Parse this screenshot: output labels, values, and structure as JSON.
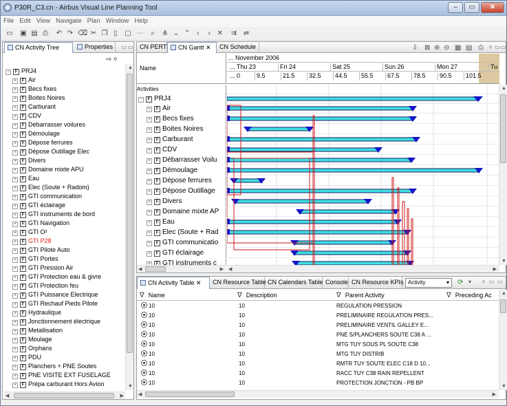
{
  "window": {
    "title": "P30R_C3.cn - Airbus Visual Line Planning Tool"
  },
  "menu": [
    "File",
    "Edit",
    "View",
    "Navigate",
    "Plan",
    "Window",
    "Help"
  ],
  "left_panel": {
    "tabs": [
      "CN Activity Tree",
      "Properties"
    ],
    "root_label": "PRJ4",
    "items": [
      "Air",
      "Becs fixes",
      "Boites Noires",
      "Carburant",
      "CDV",
      "Débarrasser voilures",
      "Démoulage",
      "Dépose ferrures",
      "Dépose Outillage Elec",
      "Divers",
      "Domaine mixte APU",
      "Eau",
      "Elec (Soute + Radom)",
      "GTI communication",
      "GTI éclairage",
      "GTI instruments de bord",
      "GTI Navigation",
      "GTI O²",
      "GTI P28",
      "GTI Pilote Auto",
      "GTI Portes",
      "GTI Pression Air",
      "GTI Protection eau & givre",
      "GTI Protection feu",
      "GTI Puissance Electrique",
      "GTI Rechauf Pieds Pilote",
      "Hydraulique",
      "Jonctionnement électrique",
      "Metallisation",
      "Moulage",
      "Orphans",
      "PDU",
      "Planchers + PNE Soutes",
      "PNE VISITE EXT FUSELAGE",
      "Prépa carburant Hors Avion"
    ],
    "highlighted_item": "GTI P28",
    "highlight_color": "#e0201a"
  },
  "gantt": {
    "tabs": [
      "CN PERT",
      "CN Gantt",
      "CN Schedule"
    ],
    "header_name": "Name",
    "month_label": "... November 2006",
    "days": [
      "... Thu 23",
      "Fri 24",
      "Sat 25",
      "Sun 26",
      "Mon 27",
      "Tu"
    ],
    "hours": [
      "... 0",
      "9.5",
      "21.5",
      "32.5",
      "44.5",
      "55.5",
      "67.5",
      "78.5",
      "90.5",
      "101.5"
    ],
    "activities_label": "Activities",
    "root_label": "PRJ4",
    "rows": [
      "Air",
      "Becs fixes",
      "Boites Noires",
      "Carburant",
      "CDV",
      "Débarrasser Voilu",
      "Démoulage",
      "Dépose ferrures",
      "Dépose Outillage",
      "Divers",
      "Domaine mixte AP",
      "Eau",
      "Elec (Soute + Rad",
      "GTI communicatio",
      "GTI éclairage",
      "GTI instruments c"
    ],
    "bar_color": "#3fe0e0",
    "marker_color": "#1515c8",
    "dependency_color": "#cc1a1a"
  },
  "bottom_panel": {
    "tabs": [
      "CN Activity Table",
      "CN Resource Table",
      "CN Calendars Table",
      "Console",
      "CN Resource KPIs"
    ],
    "activity_dropdown": "Activity",
    "columns": [
      "Name",
      "Description",
      "Parent Activity",
      "Preceding Ac"
    ],
    "rows": [
      {
        "name": "10",
        "description": "10",
        "parent": "REGULATION PRESSION"
      },
      {
        "name": "10",
        "description": "10",
        "parent": "PRELIMINAIRE REGULATION PRES..."
      },
      {
        "name": "10",
        "description": "10",
        "parent": "PRELIMINAIRE VENTIL  GALLEY E..."
      },
      {
        "name": "10",
        "description": "10",
        "parent": "PNE S/PLANCHERS SOUTE C38 A ..."
      },
      {
        "name": "10",
        "description": "10",
        "parent": "MTG TUY SOUS PL SOUTE C38"
      },
      {
        "name": "10",
        "description": "10",
        "parent": "MTG TUY DISTRIB"
      },
      {
        "name": "10",
        "description": "10",
        "parent": "RMTR TUY SOUTE ELEC C18 D 10..."
      },
      {
        "name": "10",
        "description": "10",
        "parent": "RACC TUY C38 RAIN REPELLENT"
      },
      {
        "name": "10",
        "description": "10",
        "parent": "PROTECTION JONCTION - PB BP"
      }
    ]
  }
}
